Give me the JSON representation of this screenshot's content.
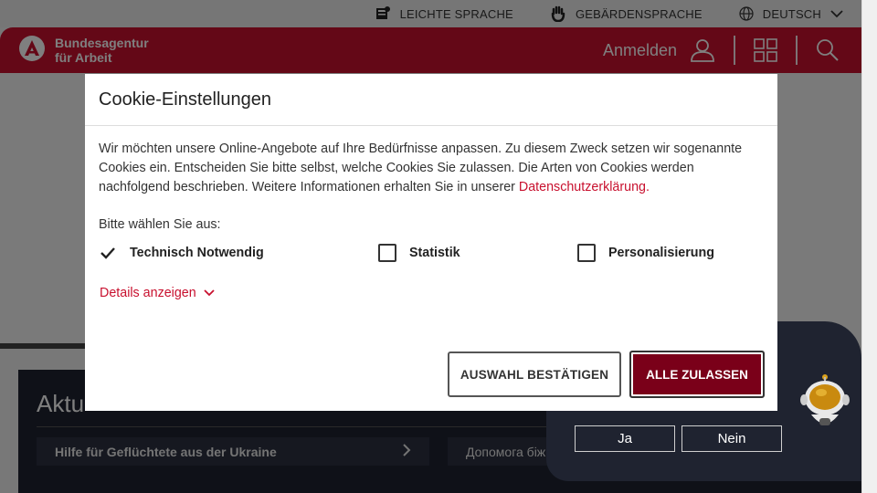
{
  "utility_bar": {
    "easy_language": "LEICHTE SPRACHE",
    "sign_language": "GEBÄRDENSPRACHE",
    "language": "DEUTSCH"
  },
  "header": {
    "logo_line1": "Bundesagentur",
    "logo_line2": "für Arbeit",
    "login": "Anmelden",
    "brand_color": "#c8102e"
  },
  "news": {
    "title": "Aktu",
    "link1": "Hilfe für Geflüchtete aus der Ukraine",
    "link2": "Допомога біж"
  },
  "chat": {
    "yes": "Ja",
    "no": "Nein"
  },
  "modal": {
    "title": "Cookie-Einstellungen",
    "body": "Wir möchten unsere Online-Angebote auf Ihre Bedürfnisse anpassen. Zu diesem Zweck setzen wir sogenannte Cookies ein. Entscheiden Sie bitte selbst, welche Cookies Sie zulassen. Die Arten von Cookies werden nachfolgend beschrieben. Weitere Informationen erhalten Sie in unserer ",
    "privacy_link": "Datenschutzerklärung.",
    "choose_label": "Bitte wählen Sie aus:",
    "options": [
      {
        "label": "Technisch Notwendig",
        "checked": true
      },
      {
        "label": "Statistik",
        "checked": false
      },
      {
        "label": "Personalisierung",
        "checked": false
      }
    ],
    "details": "Details anzeigen",
    "confirm_button": "AUSWAHL BESTÄTIGEN",
    "accept_all_button": "ALLE ZULASSEN",
    "accent_color": "#7a0019"
  }
}
